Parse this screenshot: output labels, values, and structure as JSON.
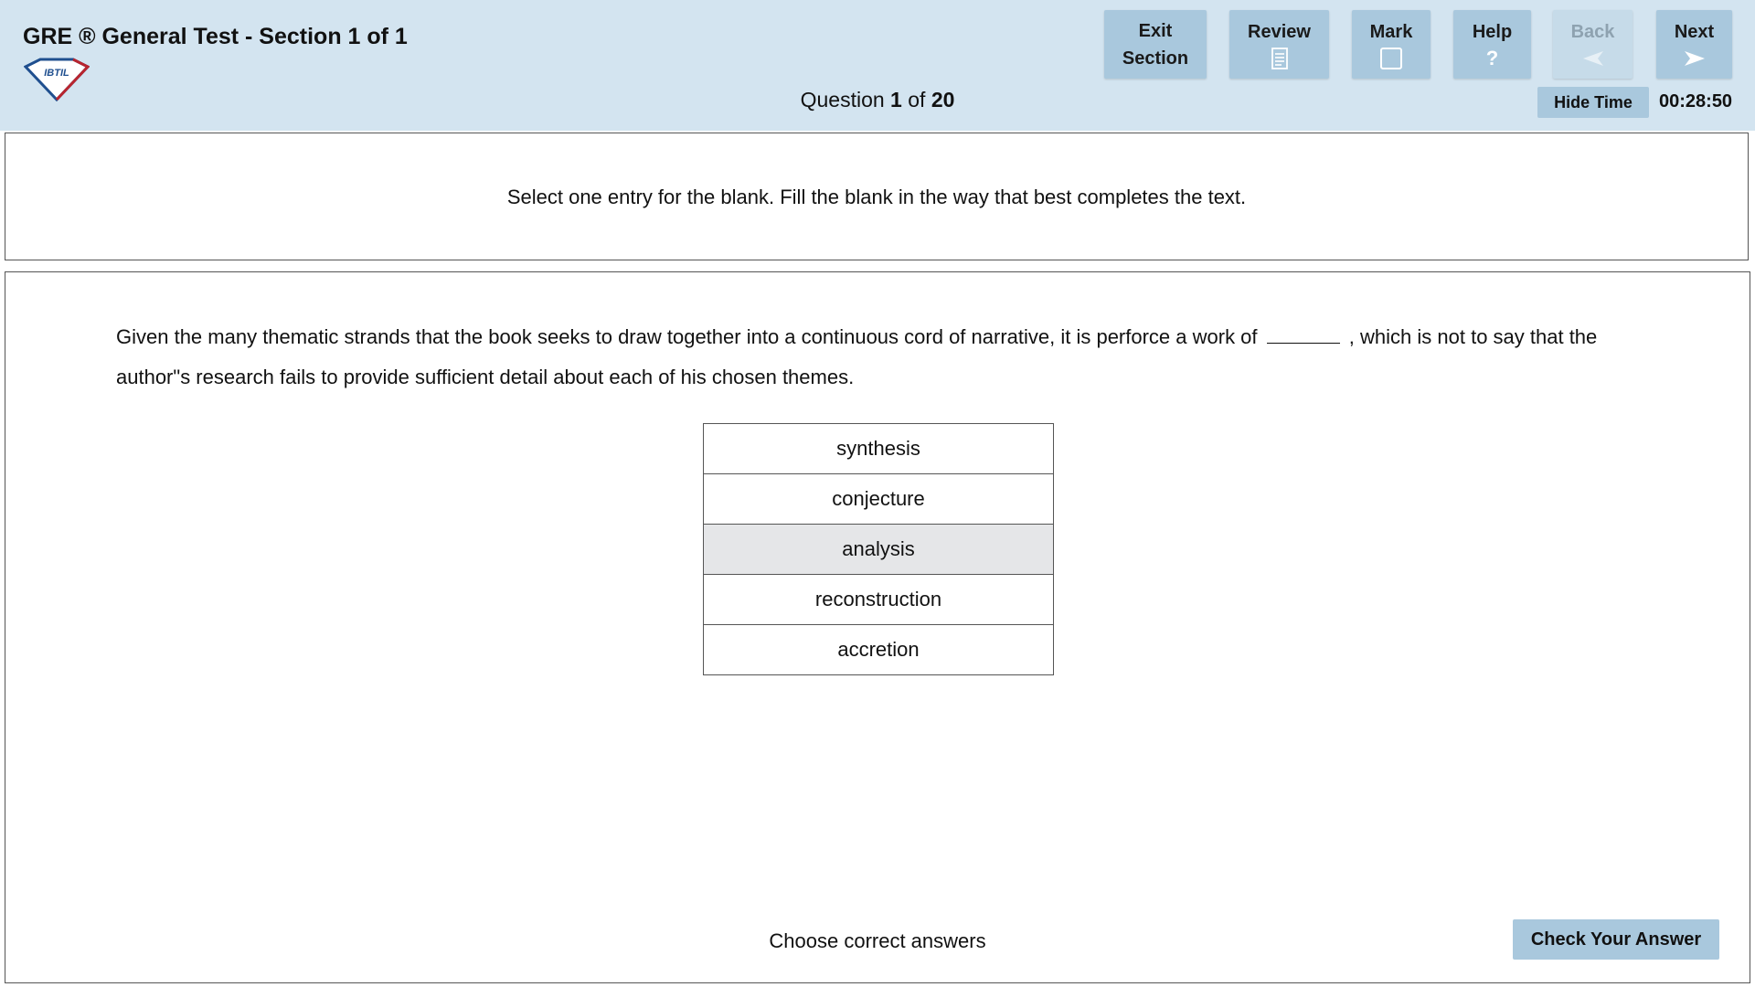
{
  "header": {
    "title": "GRE ® General Test - Section 1 of 1",
    "logo_text": "IBTIL",
    "question_prefix": "Question",
    "question_number": "1",
    "question_of": "of",
    "question_total": "20",
    "toolbar": {
      "exit_line1": "Exit",
      "exit_line2": "Section",
      "review": "Review",
      "mark": "Mark",
      "help": "Help",
      "help_glyph": "?",
      "back": "Back",
      "next": "Next"
    },
    "hide_time": "Hide Time",
    "timer": "00:28:50"
  },
  "directions": "Select one entry for the blank. Fill the blank in the way that best completes the text.",
  "question": {
    "stem_before": "Given the many thematic strands that the book seeks to draw together into a continuous cord of narrative, it is perforce a work of",
    "stem_after": ", which is not to say that the author\"s research fails to provide sufficient detail about each of his chosen themes.",
    "choices": [
      "synthesis",
      "conjecture",
      "analysis",
      "reconstruction",
      "accretion"
    ],
    "selected_choice": "analysis"
  },
  "footer": {
    "choose_label": "Choose correct answers",
    "check_button": "Check Your Answer"
  },
  "colors": {
    "header_bg": "#d3e4f0",
    "button_bg": "#a9c8dd",
    "selected_choice_bg": "#e5e6e8"
  }
}
